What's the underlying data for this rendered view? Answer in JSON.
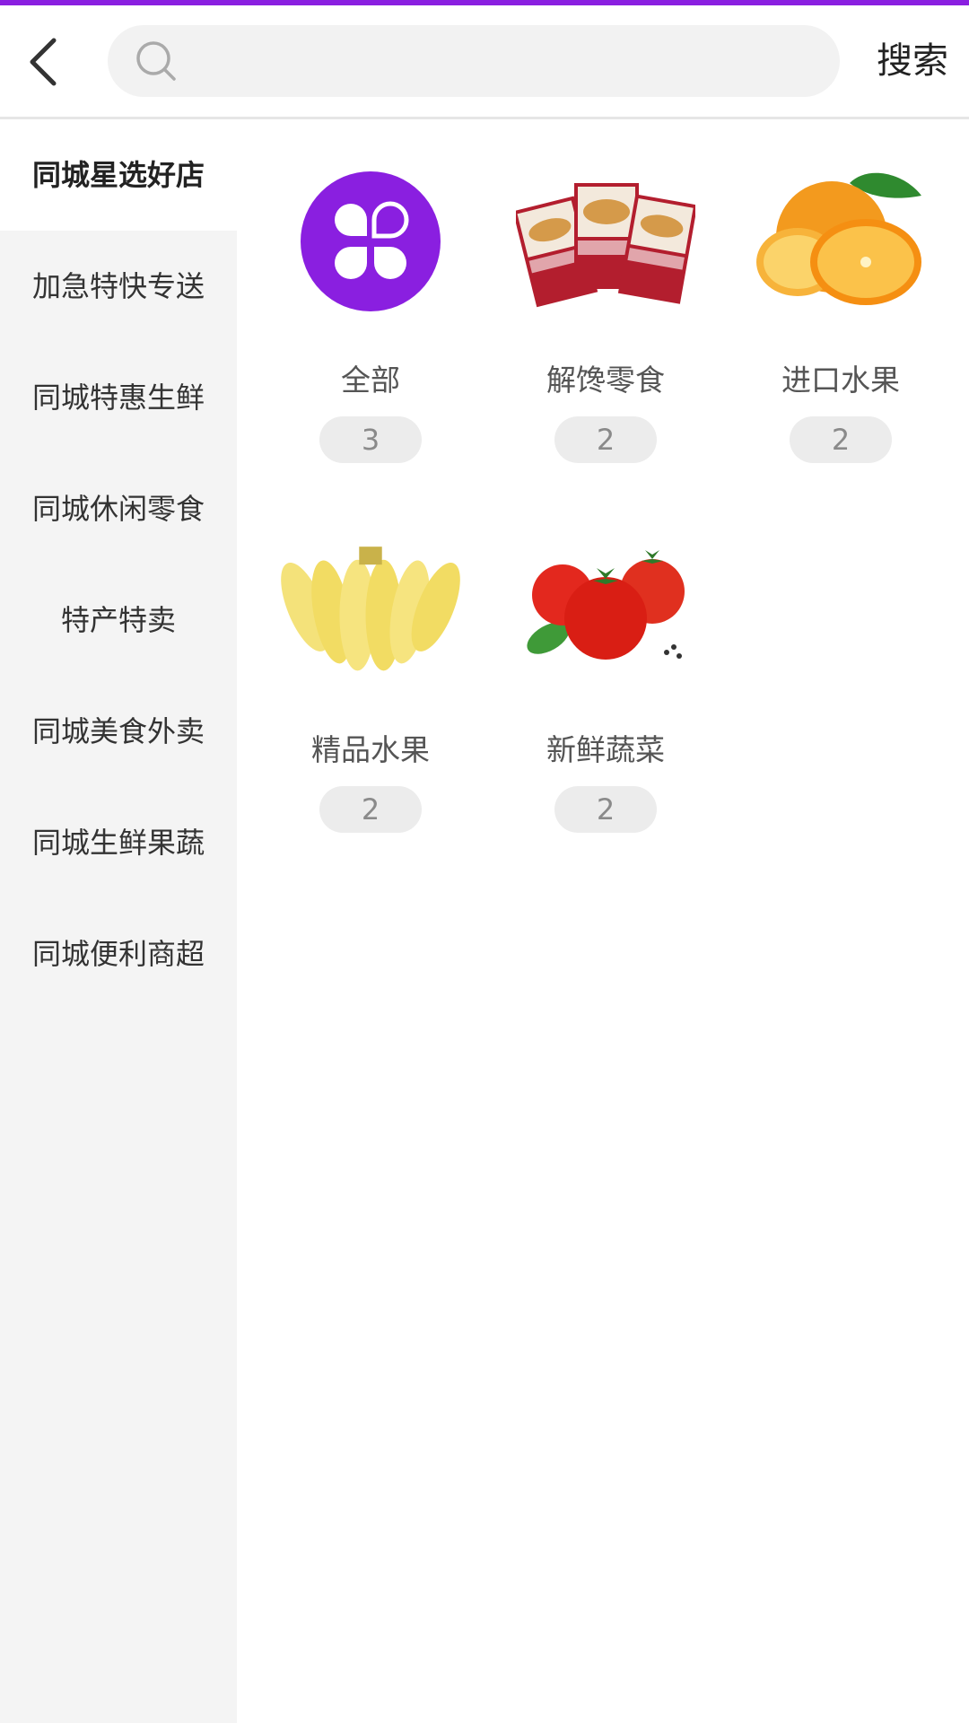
{
  "theme": {
    "accent": "#8a1fe0",
    "sidebar_bg": "#f4f4f4"
  },
  "header": {
    "back_icon": "chevron-left-icon",
    "search_placeholder": "",
    "search_label": "搜索"
  },
  "sidebar": {
    "items": [
      {
        "label": "同城星选好店",
        "active": true
      },
      {
        "label": "加急特快专送"
      },
      {
        "label": "同城特惠生鲜"
      },
      {
        "label": "同城休闲零食"
      },
      {
        "label": "特产特卖"
      },
      {
        "label": "同城美食外卖"
      },
      {
        "label": "同城生鲜果蔬"
      },
      {
        "label": "同城便利商超"
      }
    ]
  },
  "categories": [
    {
      "name": "全部",
      "count": "3",
      "icon": "all-categories-icon"
    },
    {
      "name": "解馋零食",
      "count": "2",
      "icon": "snack-crackers-image"
    },
    {
      "name": "进口水果",
      "count": "2",
      "icon": "orange-image"
    },
    {
      "name": "精品水果",
      "count": "2",
      "icon": "banana-image"
    },
    {
      "name": "新鲜蔬菜",
      "count": "2",
      "icon": "tomato-image"
    }
  ]
}
